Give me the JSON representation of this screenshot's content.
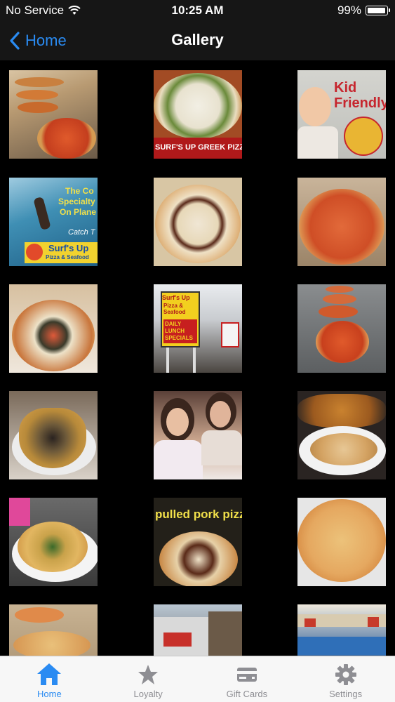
{
  "status": {
    "carrier": "No Service",
    "time": "10:25 AM",
    "battery": "99%",
    "battery_level": 0.99
  },
  "nav": {
    "back_label": "Home",
    "title": "Gallery"
  },
  "gallery": {
    "captions": {
      "greek": "SURF'S UP GREEK PIZZA",
      "kid": "Kid Friendly",
      "ad_l1": "The Co",
      "ad_l2": "Specialty",
      "ad_l3": "On Plane",
      "ad_catch": "Catch T",
      "ad_brand": "Surf's Up",
      "ad_brand2": "Pizza & Seafood",
      "sign_l1": "Surf's Up",
      "sign_l2": "Pizza & Seafood",
      "sign_l3": "DAILY LUNCH SPECIALS",
      "pulled": "pulled pork pizza"
    }
  },
  "tabs": [
    {
      "label": "Home",
      "icon": "home-icon",
      "active": true
    },
    {
      "label": "Loyalty",
      "icon": "star-icon",
      "active": false
    },
    {
      "label": "Gift Cards",
      "icon": "gift-cards-icon",
      "active": false
    },
    {
      "label": "Settings",
      "icon": "gear-icon",
      "active": false
    }
  ],
  "colors": {
    "accent": "#2a8bf2",
    "bar": "#161616",
    "tab_inactive": "#8e8e93"
  }
}
